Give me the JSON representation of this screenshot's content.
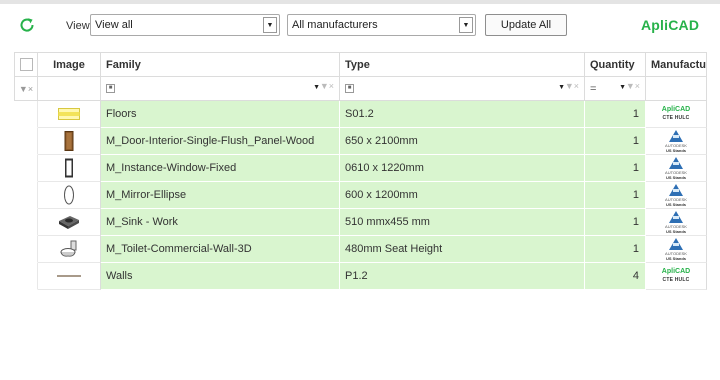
{
  "toolbar": {
    "refresh_icon": "refresh-icon",
    "view_label": "View",
    "view_select": "View all",
    "manufacturer_select": "All manufacturers",
    "update_button": "Update All",
    "brand": "ApliCAD"
  },
  "grid": {
    "columns": [
      "Image",
      "Family",
      "Type",
      "Quantity",
      "Manufactur"
    ],
    "filter": {
      "quantity_operator": "="
    },
    "rows": [
      {
        "family": "Floors",
        "type": "S01.2",
        "quantity": "1",
        "image": "floor-thumbnail",
        "manufacturer": {
          "kind": "aplicad",
          "line1": "ApliCAD",
          "line2": "CTE HULC"
        }
      },
      {
        "family": "M_Door-Interior-Single-Flush_Panel-Wood",
        "type": "650 x 2100mm",
        "quantity": "1",
        "image": "door-thumbnail",
        "manufacturer": {
          "kind": "autodesk",
          "line1": "AUTODESK",
          "line2": "US Stands"
        }
      },
      {
        "family": "M_Instance-Window-Fixed",
        "type": "0610 x 1220mm",
        "quantity": "1",
        "image": "window-thumbnail",
        "manufacturer": {
          "kind": "autodesk",
          "line1": "AUTODESK",
          "line2": "US Stands"
        }
      },
      {
        "family": "M_Mirror-Ellipse",
        "type": "600 x 1200mm",
        "quantity": "1",
        "image": "mirror-thumbnail",
        "manufacturer": {
          "kind": "autodesk",
          "line1": "AUTODESK",
          "line2": "US Stands"
        }
      },
      {
        "family": "M_Sink - Work",
        "type": "510 mmx455 mm",
        "quantity": "1",
        "image": "sink-thumbnail",
        "manufacturer": {
          "kind": "autodesk",
          "line1": "AUTODESK",
          "line2": "US Stands"
        }
      },
      {
        "family": "M_Toilet-Commercial-Wall-3D",
        "type": "480mm Seat Height",
        "quantity": "1",
        "image": "toilet-thumbnail",
        "manufacturer": {
          "kind": "autodesk",
          "line1": "AUTODESK",
          "line2": "US Stands"
        }
      },
      {
        "family": "Walls",
        "type": "P1.2",
        "quantity": "4",
        "image": "wall-thumbnail",
        "manufacturer": {
          "kind": "aplicad",
          "line1": "ApliCAD",
          "line2": "CTE HULC"
        }
      }
    ]
  },
  "colors": {
    "row_highlight": "#d9f5cf",
    "brand": "#27b24a",
    "autodesk": "#2e6fb4"
  }
}
